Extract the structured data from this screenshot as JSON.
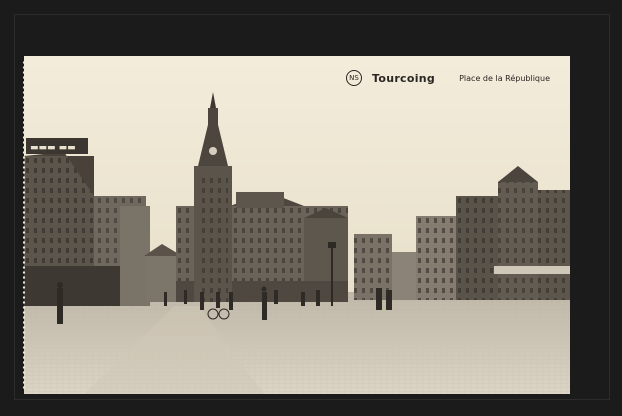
{
  "postcard": {
    "city": "Tourcoing",
    "place": "Place de la République",
    "logo_glyph": "NS"
  },
  "scene": {
    "icon_names": [
      "town-hall-icon",
      "bell-tower-icon",
      "building-row-icon",
      "pedestrian-icon",
      "street-lamp-icon",
      "cyclist-icon"
    ],
    "colors": {
      "sky": "#efe7d3",
      "stone_dark": "#3c3732",
      "stone_mid": "#6b645b",
      "pavement": "#d8d1c2",
      "card": "#f1ead9"
    }
  }
}
